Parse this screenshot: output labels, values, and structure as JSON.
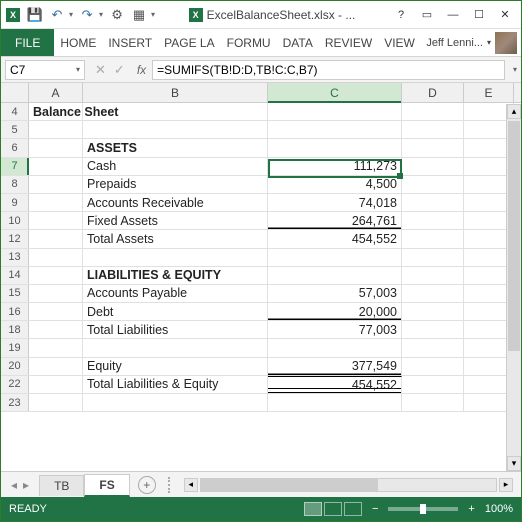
{
  "title": "ExcelBalanceSheet.xlsx - ...",
  "tabs": {
    "file": "FILE",
    "home": "HOME",
    "insert": "INSERT",
    "pagela": "PAGE LA",
    "formu": "FORMU",
    "data": "DATA",
    "review": "REVIEW",
    "view": "VIEW"
  },
  "user": "Jeff Lenni...",
  "namebox": "C7",
  "formula": "=SUMIFS(TB!D:D,TB!C:C,B7)",
  "cols": {
    "A": "A",
    "B": "B",
    "C": "C",
    "D": "D",
    "E": "E"
  },
  "rows": {
    "r4": {
      "n": "4",
      "a": "Balance Sheet"
    },
    "r5": {
      "n": "5"
    },
    "r6": {
      "n": "6",
      "b": "ASSETS"
    },
    "r7": {
      "n": "7",
      "b": "Cash",
      "c": "111,273"
    },
    "r8": {
      "n": "8",
      "b": "Prepaids",
      "c": "4,500"
    },
    "r9": {
      "n": "9",
      "b": "Accounts Receivable",
      "c": "74,018"
    },
    "r10": {
      "n": "10",
      "b": "Fixed Assets",
      "c": "264,761"
    },
    "r12": {
      "n": "12",
      "b": "  Total Assets",
      "c": "454,552"
    },
    "r13": {
      "n": "13"
    },
    "r14": {
      "n": "14",
      "b": "LIABILITIES & EQUITY"
    },
    "r15": {
      "n": "15",
      "b": "Accounts Payable",
      "c": "57,003"
    },
    "r16": {
      "n": "16",
      "b": "Debt",
      "c": "20,000"
    },
    "r18": {
      "n": "18",
      "b": "Total Liabilities",
      "c": "77,003"
    },
    "r19": {
      "n": "19"
    },
    "r20": {
      "n": "20",
      "b": "Equity",
      "c": "377,549"
    },
    "r22": {
      "n": "22",
      "b": "Total Liabilities & Equity",
      "c": "454,552"
    },
    "r23": {
      "n": "23"
    }
  },
  "sheets": {
    "tb": "TB",
    "fs": "FS"
  },
  "status": "READY",
  "zoom": "100%",
  "chart_data": {
    "type": "table",
    "title": "Balance Sheet",
    "sections": [
      {
        "name": "ASSETS",
        "items": [
          {
            "label": "Cash",
            "value": 111273
          },
          {
            "label": "Prepaids",
            "value": 4500
          },
          {
            "label": "Accounts Receivable",
            "value": 74018
          },
          {
            "label": "Fixed Assets",
            "value": 264761
          }
        ],
        "total": {
          "label": "Total Assets",
          "value": 454552
        }
      },
      {
        "name": "LIABILITIES & EQUITY",
        "items": [
          {
            "label": "Accounts Payable",
            "value": 57003
          },
          {
            "label": "Debt",
            "value": 20000
          }
        ],
        "subtotal": {
          "label": "Total Liabilities",
          "value": 77003
        },
        "equity": {
          "label": "Equity",
          "value": 377549
        },
        "total": {
          "label": "Total Liabilities & Equity",
          "value": 454552
        }
      }
    ]
  }
}
